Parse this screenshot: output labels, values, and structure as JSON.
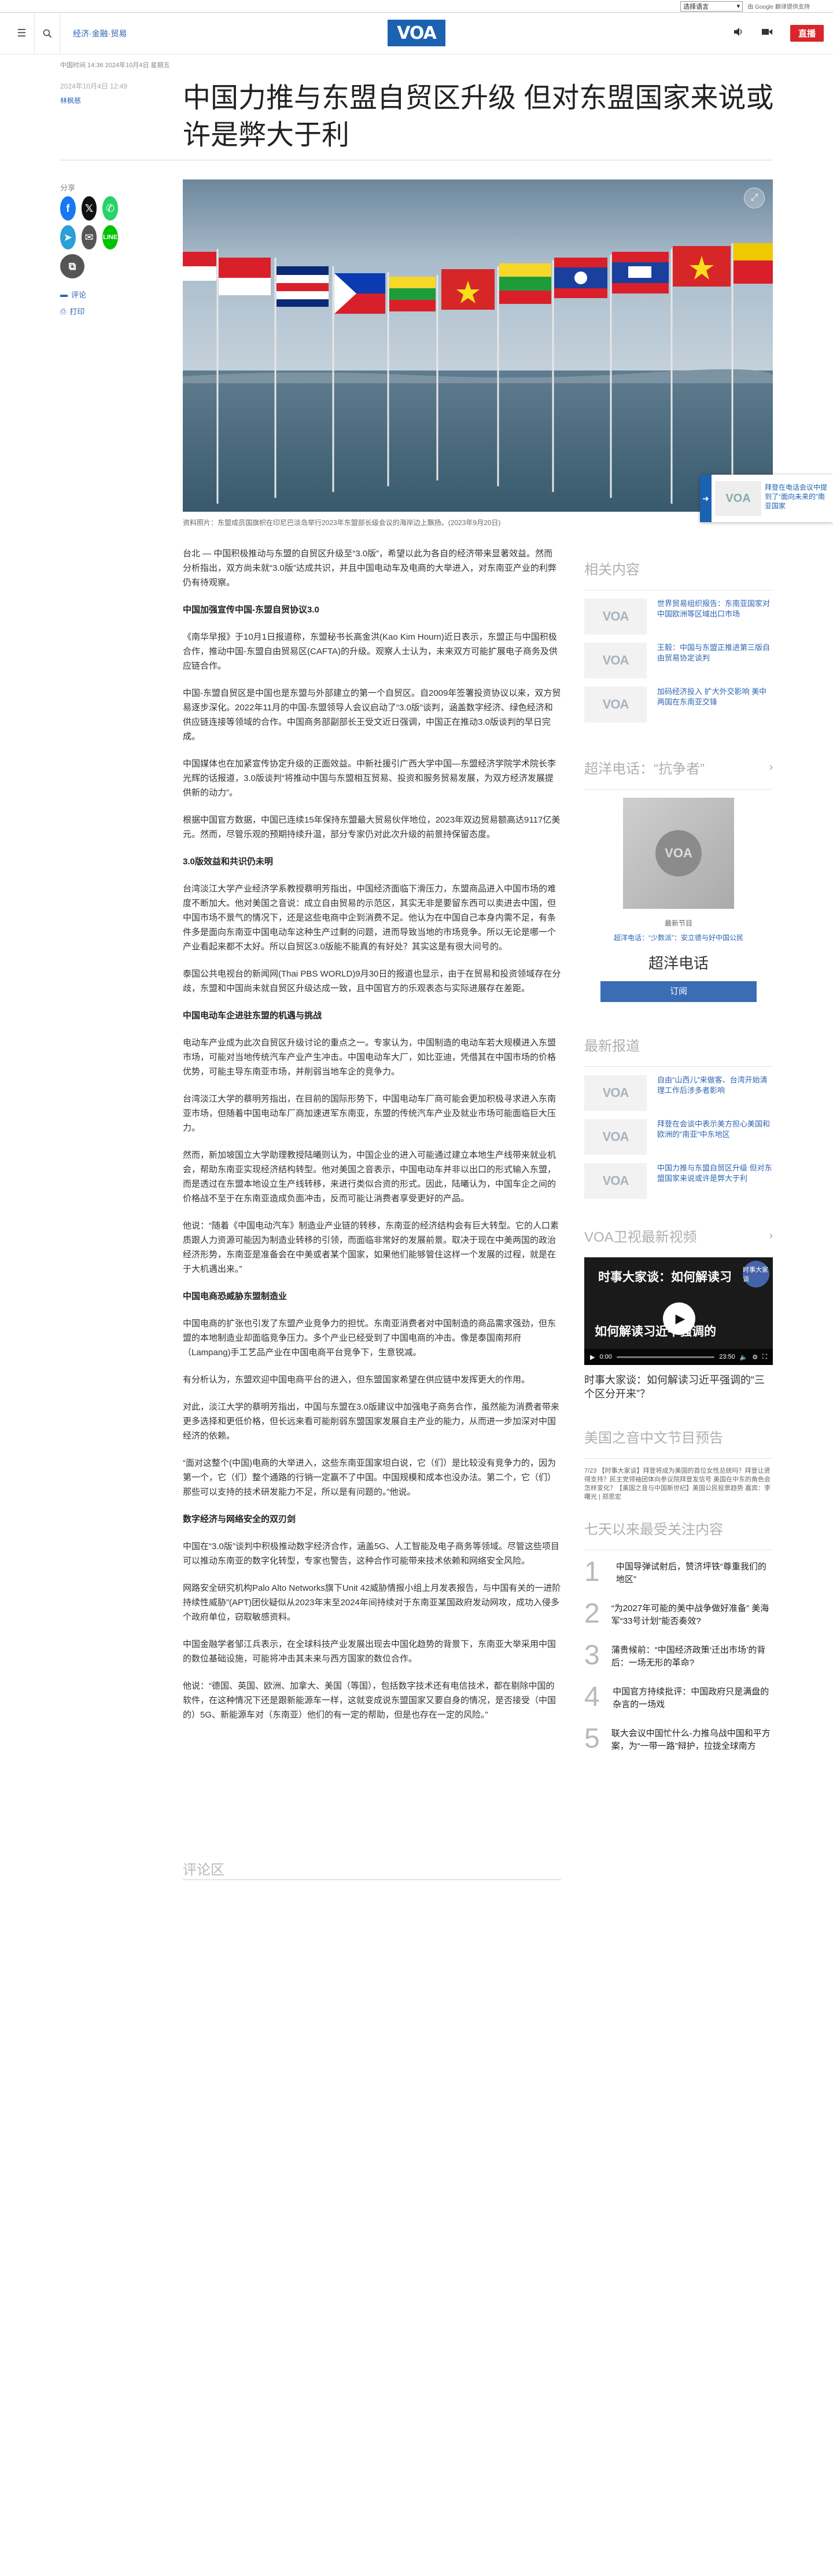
{
  "translate": {
    "select_label": "选择语言",
    "credit": "由 Google 翻译提供支持"
  },
  "header": {
    "section": "经济·金融·贸易",
    "logo": "VOA",
    "live": "直播"
  },
  "article": {
    "meta_top": "中国时间 14:36 2024年10月4日 星期五",
    "date": "2024年10月4日 12:49",
    "author": "林枫慈",
    "title": "中国力推与东盟自贸区升级 但对东盟国家来说或许是弊大于利",
    "caption": "资料照片：东盟成员国旗帜在印尼巴淡岛举行2023年东盟部长级会议的海岸边上飘扬。(2023年9月20日)",
    "share_label": "分享",
    "comment_link": "评论",
    "print_link": "打印",
    "paragraphs": [
      {
        "type": "p",
        "text": "台北 — 中国积极推动与东盟的自贸区升级至“3.0版”，希望以此为各自的经济带来显著效益。然而分析指出，双方尚未就“3.0版”达成共识，并且中国电动车及电商的大举进入，对东南亚产业的利弊仍有待观察。"
      },
      {
        "type": "h",
        "text": "中国加强宣传中国-东盟自贸协议3.0"
      },
      {
        "type": "p",
        "text": "《南华早报》于10月1日报道称，东盟秘书长高金洪(Kao Kim Hourn)近日表示，东盟正与中国积极合作，推动中国-东盟自由贸易区(CAFTA)的升级。观察人士认为，未来双方可能扩展电子商务及供应链合作。"
      },
      {
        "type": "p",
        "text": "中国-东盟自贸区是中国也是东盟与外部建立的第一个自贸区。自2009年签署投资协议以来，双方贸易逐步深化。2022年11月的中国-东盟领导人会议启动了“3.0版”谈判，涵盖数字经济、绿色经济和供应链连接等领域的合作。中国商务部副部长王受文近日强调，中国正在推动3.0版谈判的早日完成。"
      },
      {
        "type": "p",
        "text": "中国媒体也在加紧宣传协定升级的正面效益。中新社援引广西大学中国—东盟经济学院学术院长李光辉的话报道，3.0版谈判“将推动中国与东盟相互贸易、投资和服务贸易发展，为双方经济发展提供新的动力”。"
      },
      {
        "type": "p",
        "text": "根据中国官方数据，中国已连续15年保持东盟最大贸易伙伴地位，2023年双边贸易额高达9117亿美元。然而，尽管乐观的预期持续升温，部分专家仍对此次升级的前景持保留态度。"
      },
      {
        "type": "h",
        "text": "3.0版效益和共识仍未明"
      },
      {
        "type": "p",
        "text": "台湾淡江大学产业经济学系教授蔡明芳指出，中国经济面临下滑压力，东盟商品进入中国市场的难度不断加大。他对美国之音说：成立自由贸易的示范区，其实无非是要留东西可以卖进去中国，但中国市场不景气的情况下，还是这些电商中企到消费不足。他认为在中国自己本身内需不足，有条件多是面向东南亚中国电动车这种生产过剩的问题，进而导致当地的市场竞争。所以无论是哪一个产业看起来都不太好。所以自贸区3.0版能不能真的有好处？其实这是有很大问号的。"
      },
      {
        "type": "p",
        "text": "泰国公共电视台的新闻网(Thai PBS WORLD)9月30日的报道也显示，由于在贸易和投资领域存在分歧，东盟和中国尚未就自贸区升级达成一致，且中国官方的乐观表态与实际进展存在差距。"
      },
      {
        "type": "h",
        "text": "中国电动车企进驻东盟的机遇与挑战"
      },
      {
        "type": "p",
        "text": "电动车产业成为此次自贸区升级讨论的重点之一。专家认为，中国制造的电动车若大规模进入东盟市场，可能对当地传统汽车产业产生冲击。中国电动车大厂，如比亚迪，凭借其在中国市场的价格优势，可能主导东南亚市场，并削弱当地车企的竞争力。"
      },
      {
        "type": "p",
        "text": "台湾淡江大学的蔡明芳指出，在目前的国际形势下，中国电动车厂商可能会更加积极寻求进入东南亚市场，但随着中国电动车厂商加速进军东南亚，东盟的传统汽车产业及就业市场可能面临巨大压力。"
      },
      {
        "type": "p",
        "text": "然而，新加坡国立大学助理教授陆曦则认为，中国企业的进入可能通过建立本地生产线带来就业机会，帮助东南亚实现经济结构转型。他对美国之音表示，中国电动车并非以出口的形式输入东盟，而是透过在东盟本地设立生产线转移，来进行类似合资的形式。因此，陆曦认为，中国车企之间的价格战不至于在东南亚造成负面冲击，反而可能让消费者享受更好的产品。"
      },
      {
        "type": "p",
        "text": "他说：“随着《中国电动汽车》制造业产业链的转移，东南亚的经济结构会有巨大转型。它的人口素质跟人力资源可能因为制造业转移的引领，而面临非常好的发展前景。取决于现在中美两国的政治经济形势，东南亚是准备会在中美或者某个国家，如果他们能够管住这样一个发展的过程，就是在于大机遇出来。”"
      },
      {
        "type": "h",
        "text": "中国电商恐威胁东盟制造业"
      },
      {
        "type": "p",
        "text": "中国电商的扩张也引发了东盟产业竞争力的担忧。东南亚消费者对中国制造的商品需求强劲，但东盟的本地制造业却面临竞争压力。多个产业已经受到了中国电商的冲击。像是泰国南邦府（Lampang)手工艺品产业在中国电商平台竞争下，生意锐减。"
      },
      {
        "type": "p",
        "text": "有分析认为，东盟欢迎中国电商平台的进入，但东盟国家希望在供应链中发挥更大的作用。"
      },
      {
        "type": "p",
        "text": "对此，淡江大学的蔡明芳指出，中国与东盟在3.0版建议中加强电子商务合作，虽然能为消费者带来更多选择和更低价格，但长远来看可能削弱东盟国家发展自主产业的能力，从而进一步加深对中国经济的依赖。"
      },
      {
        "type": "p",
        "text": "“面对这整个(中国)电商的大举进入，这些东南亚国家坦白说，它（们）是比较没有竞争力的，因为第一个，它（们）整个通路的行销一定赢不了中国。中国规模和成本也没办法。第二个，它（们）那些可以支持的技术研发能力不足，所以是有问题的。”他说。"
      },
      {
        "type": "h",
        "text": "数字经济与网络安全的双刃剑"
      },
      {
        "type": "p",
        "text": "中国在“3.0版”谈判中积极推动数字经济合作，涵盖5G、人工智能及电子商务等领域。尽管这些项目可以推动东南亚的数字化转型，专家也警告，这种合作可能带来技术依赖和网络安全风险。"
      },
      {
        "type": "p",
        "text": "网路安全研究机构Palo Alto Networks旗下Unit 42威胁情报小组上月发表报告，与中国有关的一进阶持续性威胁”(APT)团伙疑似从2023年末至2024年间持续对于东南亚某国政府发动网攻，成功入侵多个政府单位，窃取敏感资料。"
      },
      {
        "type": "p",
        "text": "中国金融学者邹江兵表示，在全球科技产业发展出现去中国化趋势的背景下，东南亚大举采用中国的数位基础设施，可能将冲击其未来与西方国家的数位合作。"
      },
      {
        "type": "p",
        "text": "他说：“德国、英国、欧洲、加拿大、美国（等国），包括数字技术还有电信技术，都在剔除中国的软件，在这种情况下还是跟新能源车一样，这就变成说东盟国家又要自身的情况，是否接受（中国的）5G、新能源车对（东南亚）他们的有一定的帮助，但是也存在一定的风险。”"
      }
    ],
    "comments_title": "评论区"
  },
  "float_card": {
    "text": "拜登在电话会议中提到了“面向未来的”南亚国家"
  },
  "sidebar": {
    "related_title": "相关内容",
    "related": [
      {
        "text": "世界贸易组织报告：东南亚国家对中国欧洲等区域出口市场"
      },
      {
        "text": "王毅：中国与东盟正推进第三版自由贸易协定谈判"
      },
      {
        "text": "加码经济投入 扩大外交影响 美中两国在东南亚交锋"
      }
    ],
    "program_title": "超洋电话：“抗争者”",
    "program_latest": "最新节目",
    "program_sub": "超洋电话：“少数派”：安立德与好中国公民",
    "program_name": "超洋电话",
    "subscribe": "订阅",
    "latest_title": "最新报道",
    "latest": [
      {
        "text": "自由“山西儿”来做客、台湾开始清理工作后涉多者影响"
      },
      {
        "text": "拜登在会谈中表示美方担心美国和欧洲的”南亚”中东地区"
      },
      {
        "text": "中国力推与东盟自贸区升级 但对东盟国家来说或许是弊大于利"
      }
    ],
    "video_title_sec": "VOA卫视最新视频",
    "video_overlay1": "时事大家谈：如何解读习",
    "video_overlay2": "如何解读习近平强调的",
    "video_badge": "时事大家谈",
    "video_time": "0:00",
    "video_duration": "23:50",
    "video_caption": "时事大家谈：如何解读习近平强调的“三个区分开来”？",
    "schedule_title": "美国之音中文节目预告",
    "schedule_text": "7/23 【时事大家谈】拜登将成为美国的首位女性总统吗？拜登让贤得支持？民主党领袖团体向参议院拜登发信号 美国在中东的角色会怎样变化？【美国之音与中国新世纪】美国公民投票趋势  嘉宾：李曙光 | 郑思宏",
    "most_read_title": "七天以来最受关注内容",
    "most_read": [
      {
        "num": "1",
        "text": "中国导弹试射后，赞济坪铁“尊重我们的地区”"
      },
      {
        "num": "2",
        "text": "“为2027年可能的美中战争做好准备” 美海军“33号计划”能否奏效?"
      },
      {
        "num": "3",
        "text": "蒲贵候前：“中国经济政策‘迁出市场’的背后：一场无形的革命?"
      },
      {
        "num": "4",
        "text": "中国官方持续批评：中国政府只是满盘的杂言的一场戏"
      },
      {
        "num": "5",
        "text": "联大会议中国忙什么-力推乌战中国和平方案，为“一带一路”辩护，拉拢全球南方"
      }
    ]
  }
}
